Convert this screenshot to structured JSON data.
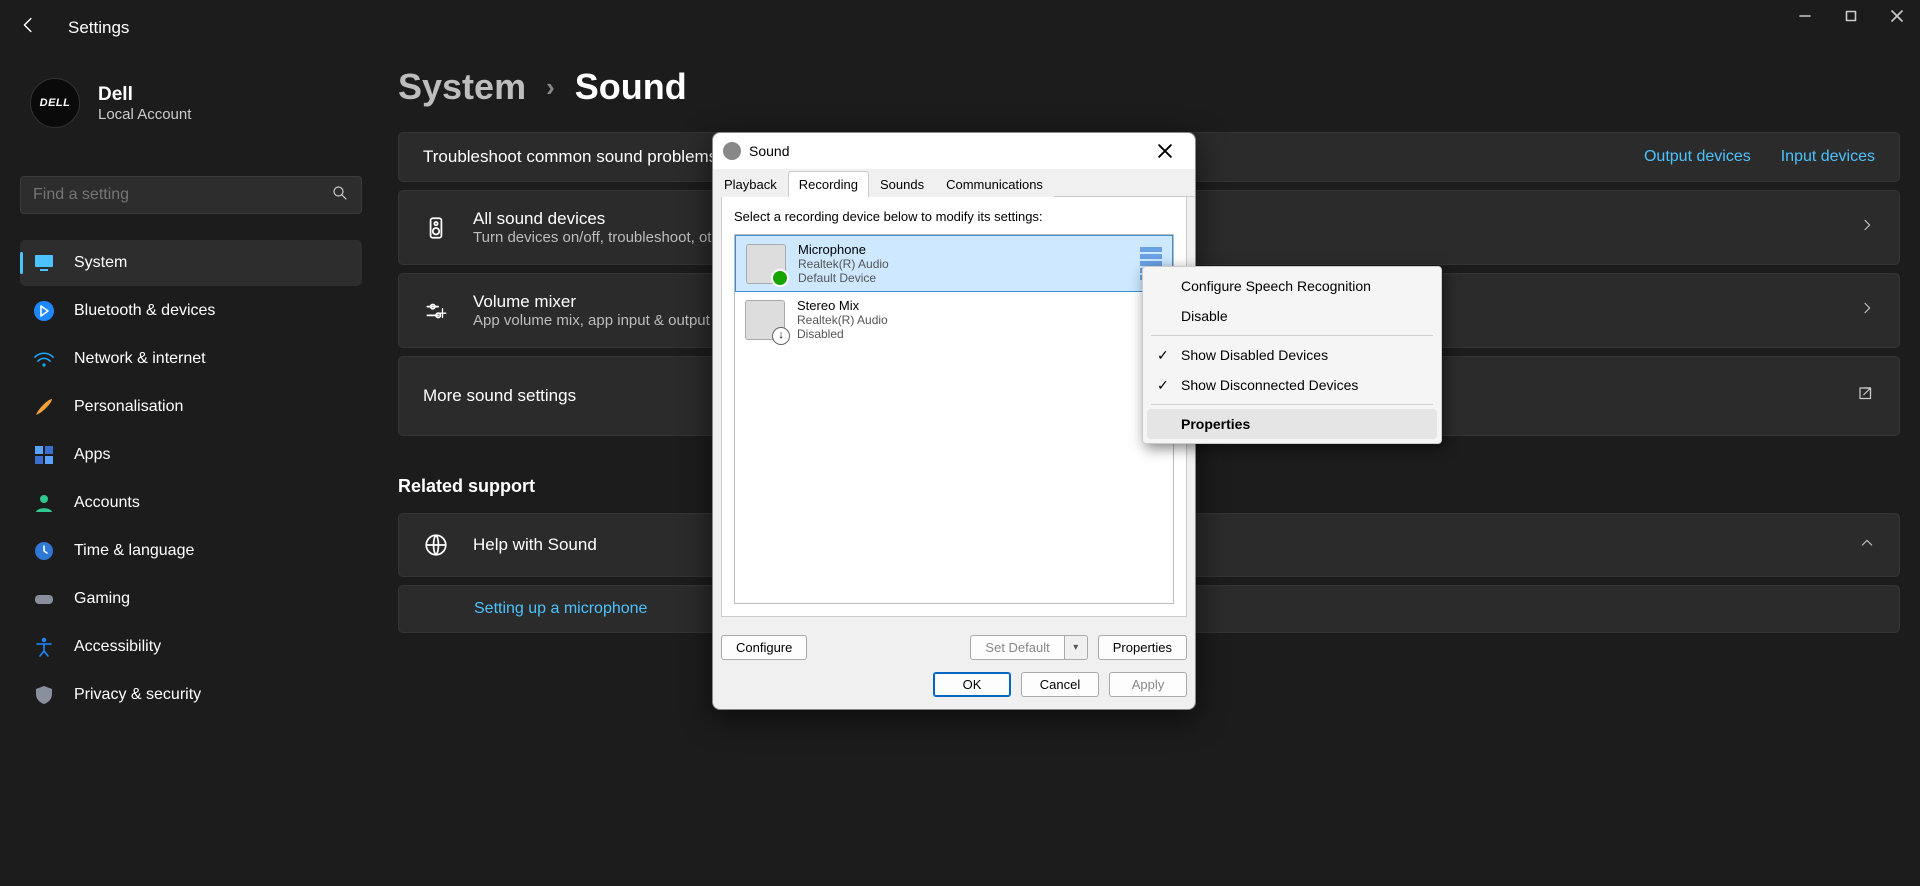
{
  "app": {
    "title": "Settings"
  },
  "profile": {
    "name": "Dell",
    "sub": "Local Account",
    "badge": "DELL"
  },
  "search": {
    "placeholder": "Find a setting"
  },
  "sidebar": {
    "items": [
      {
        "label": "System"
      },
      {
        "label": "Bluetooth & devices"
      },
      {
        "label": "Network & internet"
      },
      {
        "label": "Personalisation"
      },
      {
        "label": "Apps"
      },
      {
        "label": "Accounts"
      },
      {
        "label": "Time & language"
      },
      {
        "label": "Gaming"
      },
      {
        "label": "Accessibility"
      },
      {
        "label": "Privacy & security"
      }
    ]
  },
  "breadcrumb": {
    "parent": "System",
    "current": "Sound"
  },
  "troubleshoot": {
    "title": "Troubleshoot common sound problems",
    "link_out": "Output devices",
    "link_in": "Input devices"
  },
  "cards": {
    "all_devices": {
      "title": "All sound devices",
      "sub": "Turn devices on/off, troubleshoot, other options"
    },
    "mixer": {
      "title": "Volume mixer",
      "sub": "App volume mix, app input & output devices"
    },
    "more": {
      "title": "More sound settings"
    }
  },
  "related": {
    "heading": "Related support",
    "help": "Help with Sound",
    "mic_link": "Setting up a microphone"
  },
  "sound_dlg": {
    "title": "Sound",
    "tabs": {
      "playback": "Playback",
      "recording": "Recording",
      "sounds": "Sounds",
      "comm": "Communications"
    },
    "prompt": "Select a recording device below to modify its settings:",
    "devices": [
      {
        "name": "Microphone",
        "driver": "Realtek(R) Audio",
        "status": "Default Device"
      },
      {
        "name": "Stereo Mix",
        "driver": "Realtek(R) Audio",
        "status": "Disabled"
      }
    ],
    "buttons": {
      "configure": "Configure",
      "set_default": "Set Default",
      "properties": "Properties",
      "ok": "OK",
      "cancel": "Cancel",
      "apply": "Apply"
    }
  },
  "ctx": {
    "configure_speech": "Configure Speech Recognition",
    "disable": "Disable",
    "show_disabled": "Show Disabled Devices",
    "show_disconnected": "Show Disconnected Devices",
    "properties": "Properties"
  }
}
